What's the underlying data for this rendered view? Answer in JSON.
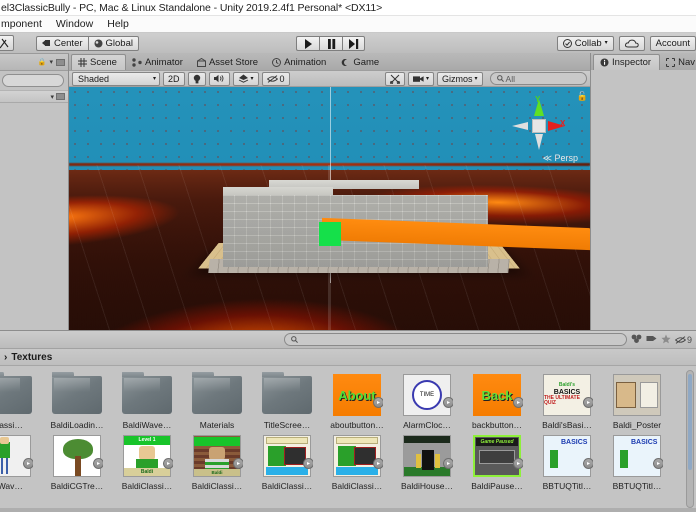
{
  "window": {
    "title": "el3ClassicBully - PC, Mac & Linux Standalone - Unity 2019.2.4f1 Personal* <DX11>"
  },
  "menubar": {
    "items": [
      "mponent",
      "Window",
      "Help"
    ]
  },
  "toolbar": {
    "tool_icon": "transform-tool-icon",
    "pivot_label": "Center",
    "pivot_icon": "pivot-icon",
    "space_label": "Global",
    "space_icon": "globe-icon",
    "play_label": "▶",
    "pause_label": "▐▐",
    "step_label": "▶|",
    "collab_label": "Collab",
    "collab_caret": "▾",
    "cloud_label": "☁",
    "account_label": "Account"
  },
  "left_panel": {
    "lock_icon": "lock-icon",
    "menu_icon": "panel-menu-icon",
    "search_placeholder": ""
  },
  "scene_panel": {
    "tabs": [
      {
        "label": "Scene",
        "icon": "grid-icon",
        "active": true
      },
      {
        "label": "Animator",
        "icon": "animator-icon",
        "active": false
      },
      {
        "label": "Asset Store",
        "icon": "store-icon",
        "active": false
      },
      {
        "label": "Animation",
        "icon": "clock-icon",
        "active": false
      },
      {
        "label": "Game",
        "icon": "gamepad-icon",
        "active": false
      }
    ],
    "toolbar": {
      "shading_mode": "Shaded",
      "shading_caret": "▾",
      "mode_2d": "2D",
      "light_icon": "lightbulb-icon",
      "audio_icon": "speaker-icon",
      "fx_icon": "fx-icon",
      "fx_caret": "▾",
      "visibility_icon": "eye-off-icon",
      "visibility_count": "0",
      "scissors_icon": "scissors-icon",
      "camera_icon": "camera-icon",
      "camera_caret": "▾",
      "gizmos_label": "Gizmos",
      "gizmos_caret": "▾",
      "search_placeholder": "All"
    },
    "gizmo": {
      "axis_y": "Y",
      "axis_x": "X",
      "perspective_label": "≪ Persp",
      "lock_icon": "unlock-icon"
    }
  },
  "right_panel": {
    "tabs": [
      {
        "label": "Inspector",
        "icon": "info-icon",
        "active": true
      },
      {
        "label": "Nav",
        "icon": "navigation-icon",
        "active": false
      }
    ]
  },
  "project_panel": {
    "search_placeholder": "",
    "breadcrumb_caret": "›",
    "breadcrumb": "Textures",
    "filters": {
      "favorite_icon": "star-icon",
      "label_icon": "label-icon",
      "type_icon": "type-icon",
      "hidden_icon": "eye-off-icon",
      "hidden_count": "9"
    },
    "rows": [
      [
        {
          "name": "Classi…",
          "kind": "folder",
          "badge": ""
        },
        {
          "name": "BaldiLoadin…",
          "kind": "folder",
          "badge": ""
        },
        {
          "name": "BaldiWave…",
          "kind": "folder",
          "badge": ""
        },
        {
          "name": "Materials",
          "kind": "folder",
          "badge": ""
        },
        {
          "name": "TitleScree…",
          "kind": "folder",
          "badge": ""
        },
        {
          "name": "aboutbutton…",
          "kind": "about",
          "badge": "▸",
          "art": "About"
        },
        {
          "name": "AlarmCloc…",
          "kind": "clock",
          "badge": "▸",
          "art": "TIME"
        },
        {
          "name": "backbutton…",
          "kind": "back",
          "badge": "▸",
          "art": "Back"
        },
        {
          "name": "Baldi'sBasi…",
          "kind": "quiz",
          "badge": "▸",
          "art": "BASICS"
        },
        {
          "name": "Baldi_Poster",
          "kind": "poster",
          "badge": "",
          "art": ""
        }
      ],
      [
        {
          "name": "i_Wav…",
          "kind": "wave",
          "badge": "▸",
          "art": ""
        },
        {
          "name": "BaldiCGTre…",
          "kind": "tree",
          "badge": "▸",
          "art": ""
        },
        {
          "name": "BaldiClassi…",
          "kind": "classic",
          "badge": "▸",
          "art": "Level 1"
        },
        {
          "name": "BaldiClassi…",
          "kind": "classic2",
          "badge": "▸",
          "art": "Baldi"
        },
        {
          "name": "BaldiClassi…",
          "kind": "classic3",
          "badge": "▸",
          "art": ""
        },
        {
          "name": "BaldiClassi…",
          "kind": "classic3",
          "badge": "▸",
          "art": ""
        },
        {
          "name": "BaldiHouse…",
          "kind": "house",
          "badge": "▸",
          "art": ""
        },
        {
          "name": "BaldiPause…",
          "kind": "pause",
          "badge": "▸",
          "art": "Game Paused"
        },
        {
          "name": "BBTUQTitl…",
          "kind": "bbtuq",
          "badge": "▸",
          "art": "BASICS"
        },
        {
          "name": "BBTUQTitl…",
          "kind": "bbtuq",
          "badge": "▸",
          "art": "BASICS"
        }
      ]
    ]
  }
}
